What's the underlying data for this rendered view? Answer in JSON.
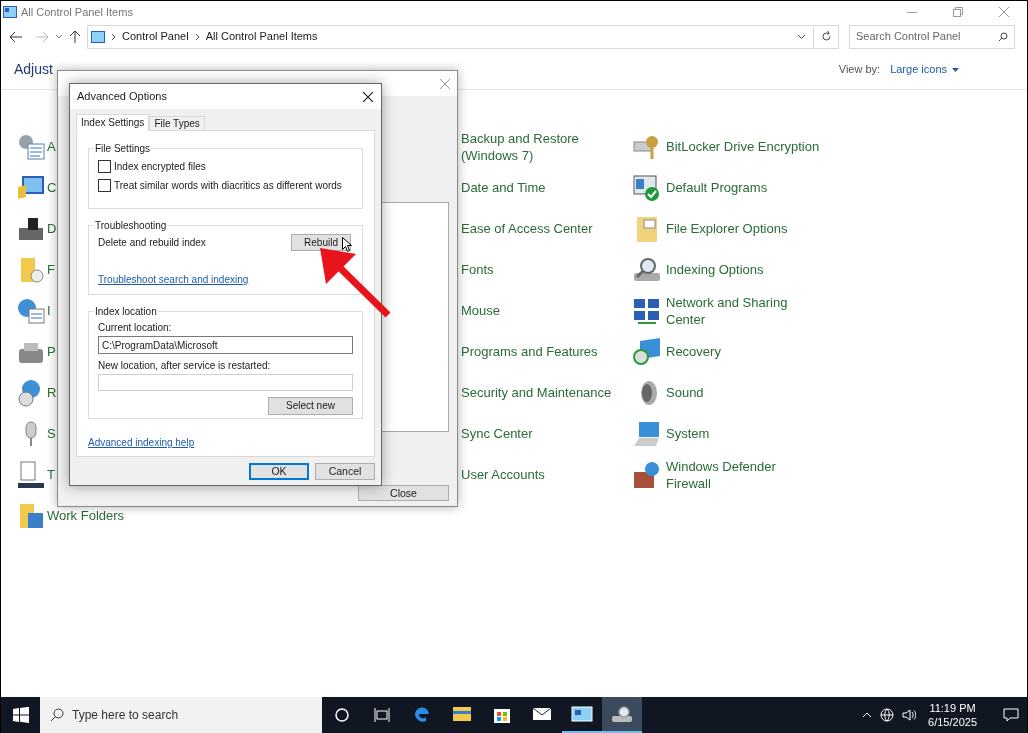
{
  "window": {
    "title": "All Control Panel Items",
    "breadcrumb": [
      "Control Panel",
      "All Control Panel Items"
    ],
    "search_placeholder": "Search Control Panel",
    "heading": "Adjust",
    "view_by_label": "View by:",
    "view_by_value": "Large icons"
  },
  "items": {
    "left": [
      {
        "label": "A"
      },
      {
        "label": "C"
      },
      {
        "label": "D"
      },
      {
        "label": "F"
      },
      {
        "label": "I"
      },
      {
        "label": "P"
      },
      {
        "label": "R"
      },
      {
        "label": "S"
      },
      {
        "label": "T"
      },
      {
        "label": "Work Folders"
      }
    ],
    "middle": [
      {
        "label": "Backup and Restore\n(Windows 7)"
      },
      {
        "label": "Date and Time"
      },
      {
        "label": "Ease of Access Center"
      },
      {
        "label": "Fonts"
      },
      {
        "label": "Mouse"
      },
      {
        "label": "Programs and Features"
      },
      {
        "label": "Security and Maintenance"
      },
      {
        "label": "Sync Center"
      },
      {
        "label": "User Accounts"
      }
    ],
    "right": [
      {
        "label": "BitLocker Drive Encryption"
      },
      {
        "label": "Default Programs"
      },
      {
        "label": "File Explorer Options"
      },
      {
        "label": "Indexing Options"
      },
      {
        "label": "Network and Sharing\nCenter"
      },
      {
        "label": "Recovery"
      },
      {
        "label": "Sound"
      },
      {
        "label": "System"
      },
      {
        "label": "Windows Defender\nFirewall"
      }
    ]
  },
  "indexing_dialog": {
    "close_button": "Close"
  },
  "advanced_dialog": {
    "title": "Advanced Options",
    "tabs": [
      {
        "label": "Index Settings",
        "selected": true
      },
      {
        "label": "File Types",
        "selected": false
      }
    ],
    "file_settings": {
      "title": "File Settings",
      "options": [
        {
          "label": "Index encrypted files",
          "checked": false
        },
        {
          "label": "Treat similar words with diacritics as different words",
          "checked": false
        }
      ]
    },
    "troubleshooting": {
      "title": "Troubleshooting",
      "label": "Delete and rebuild index",
      "button": "Rebuild",
      "link": "Troubleshoot search and indexing"
    },
    "index_location": {
      "title": "Index location",
      "current_label": "Current location:",
      "current_value": "C:\\ProgramData\\Microsoft",
      "new_label": "New location, after service is restarted:",
      "button": "Select new"
    },
    "help_link": "Advanced indexing help",
    "buttons": [
      {
        "label": "OK",
        "default": true
      },
      {
        "label": "Cancel",
        "default": false
      }
    ]
  },
  "taskbar": {
    "search_placeholder": "Type here to search",
    "time": "11:19 PM",
    "date": "6/15/2025",
    "apps": [
      {
        "kind": "edge",
        "open": false,
        "selected": false
      },
      {
        "kind": "folder",
        "open": false,
        "selected": false
      },
      {
        "kind": "store",
        "open": false,
        "selected": false
      },
      {
        "kind": "mail",
        "open": false,
        "selected": false
      },
      {
        "kind": "control",
        "open": true,
        "selected": false
      },
      {
        "kind": "indexing",
        "open": true,
        "selected": true
      }
    ]
  }
}
